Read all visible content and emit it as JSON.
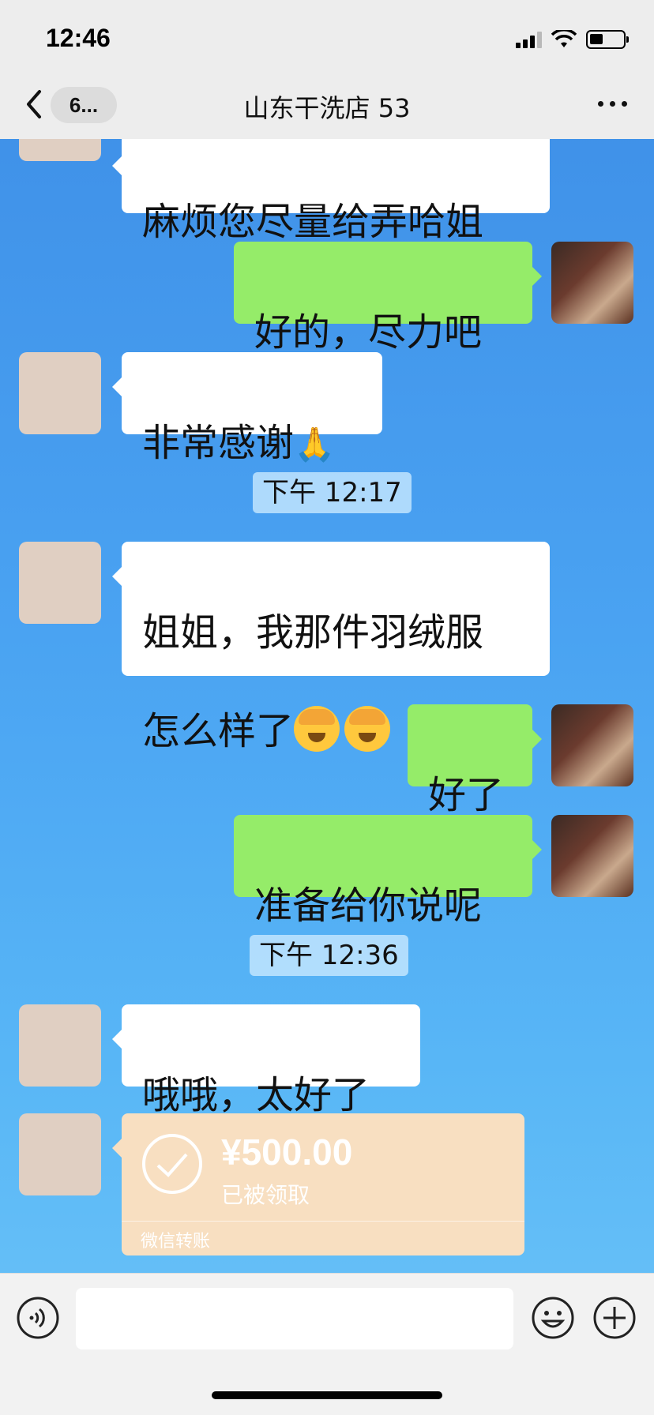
{
  "status_bar": {
    "time": "12:46"
  },
  "nav": {
    "back_count": "6...",
    "title": "山东干洗店 53"
  },
  "messages": {
    "m1": "麻烦您尽量给弄哈姐",
    "m2": "好的，尽力吧",
    "m3": "非常感谢",
    "m4_line1": "姐姐，我那件羽绒服",
    "m4_line2": "怎么样了",
    "m5": "好了",
    "m6": "准备给你说呢",
    "m7": "哦哦，太好了"
  },
  "timestamps": {
    "t1": "下午 12:17",
    "t2": "下午 12:36"
  },
  "transfer": {
    "amount": "¥500.00",
    "status": "已被领取",
    "label": "微信转账"
  },
  "icons": [
    "back-chevron-icon",
    "more-icon",
    "voice-icon",
    "emoji-icon",
    "plus-icon",
    "check-icon",
    "pray-emoji-icon",
    "facepalm-emoji-icon",
    "signal-icon",
    "wifi-icon",
    "battery-icon"
  ],
  "colors": {
    "nav_bg": "#ededed",
    "green_bubble": "#95ec69",
    "transfer_bg": "#f8dfc1"
  }
}
